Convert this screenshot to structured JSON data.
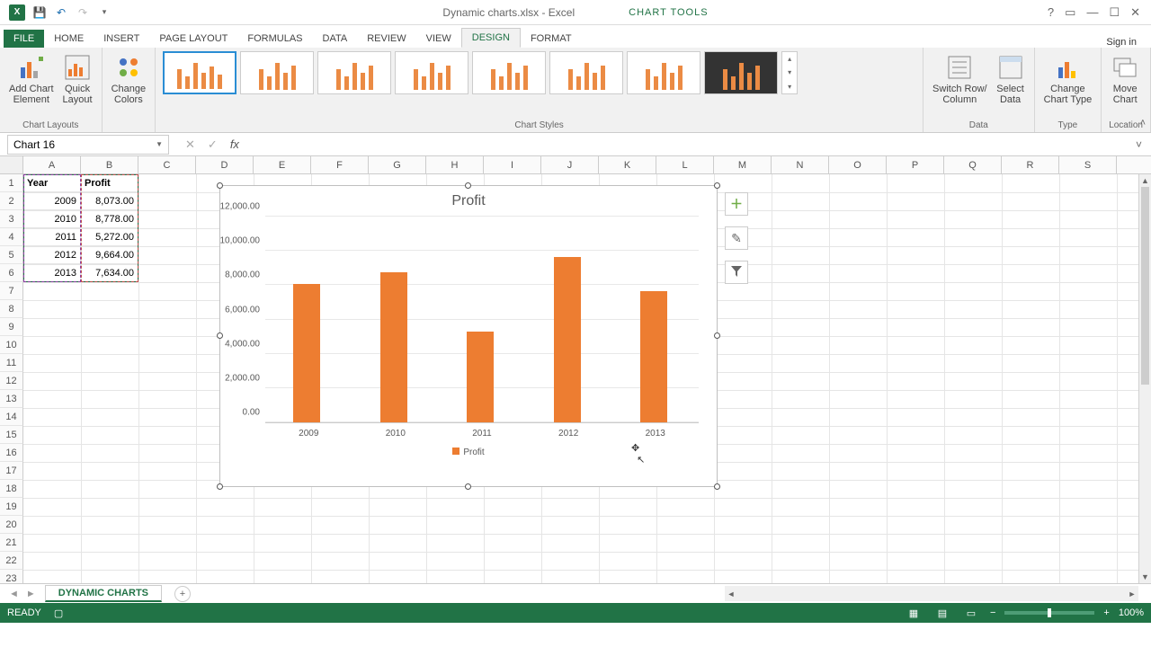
{
  "app": {
    "title": "Dynamic charts.xlsx - Excel",
    "contextual_tab_group": "CHART TOOLS"
  },
  "titlebar": {
    "help": "?",
    "restore_wb": "▭",
    "minimize": "—",
    "maximize": "☐",
    "close": "✕",
    "signin": "Sign in"
  },
  "tabs": {
    "file": "FILE",
    "home": "HOME",
    "insert": "INSERT",
    "page_layout": "PAGE LAYOUT",
    "formulas": "FORMULAS",
    "data": "DATA",
    "review": "REVIEW",
    "view": "VIEW",
    "design": "DESIGN",
    "format": "FORMAT"
  },
  "ribbon": {
    "chart_layouts": {
      "add_chart_element": "Add Chart\nElement",
      "quick_layout": "Quick\nLayout",
      "label": "Chart Layouts"
    },
    "change_colors": "Change\nColors",
    "chart_styles_label": "Chart Styles",
    "switch_row_col": "Switch Row/\nColumn",
    "select_data": "Select\nData",
    "data_label": "Data",
    "change_chart_type": "Change\nChart Type",
    "type_label": "Type",
    "move_chart": "Move\nChart",
    "location_label": "Location"
  },
  "namebox": {
    "value": "Chart 16"
  },
  "fx": "fx",
  "columns": [
    "A",
    "B",
    "C",
    "D",
    "E",
    "F",
    "G",
    "H",
    "I",
    "J",
    "K",
    "L",
    "M",
    "N",
    "O",
    "P",
    "Q",
    "R",
    "S"
  ],
  "rows": [
    "1",
    "2",
    "3",
    "4",
    "5",
    "6",
    "7",
    "8",
    "9",
    "10",
    "11",
    "12",
    "13",
    "14",
    "15",
    "16",
    "17",
    "18",
    "19",
    "20",
    "21",
    "22",
    "23"
  ],
  "table": {
    "headers": {
      "a": "Year",
      "b": "Profit"
    },
    "data": [
      {
        "year": "2009",
        "profit": "8,073.00"
      },
      {
        "year": "2010",
        "profit": "8,778.00"
      },
      {
        "year": "2011",
        "profit": "5,272.00"
      },
      {
        "year": "2012",
        "profit": "9,664.00"
      },
      {
        "year": "2013",
        "profit": "7,634.00"
      }
    ]
  },
  "chart_data": {
    "type": "bar",
    "title": "Profit",
    "categories": [
      "2009",
      "2010",
      "2011",
      "2012",
      "2013"
    ],
    "series": [
      {
        "name": "Profit",
        "values": [
          8073.0,
          8778.0,
          5272.0,
          9664.0,
          7634.0
        ]
      }
    ],
    "ylim": [
      0,
      12000
    ],
    "y_ticks": [
      "0.00",
      "2,000.00",
      "4,000.00",
      "6,000.00",
      "8,000.00",
      "10,000.00",
      "12,000.00"
    ],
    "xlabel": "",
    "ylabel": ""
  },
  "chart_side": {
    "add": "＋",
    "style": "✎",
    "filter": "⧩"
  },
  "sheet": {
    "name": "DYNAMIC CHARTS",
    "add": "+"
  },
  "status": {
    "ready": "READY",
    "zoom": "100%"
  }
}
